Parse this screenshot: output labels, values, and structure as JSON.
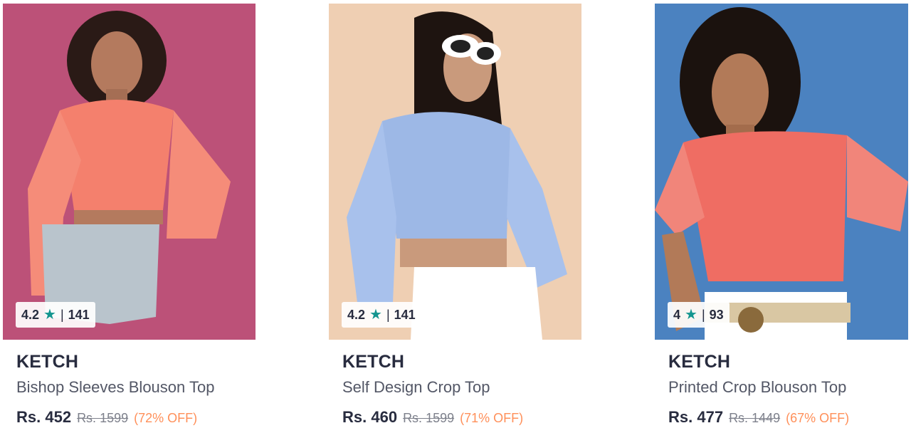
{
  "products": [
    {
      "brand": "KETCH",
      "name": "Bishop Sleeves Blouson Top",
      "rating": "4.2",
      "rating_count": "141",
      "price": "Rs. 452",
      "mrp": "Rs. 1599",
      "discount": "(72% OFF)",
      "image_colors": {
        "background": "#b84e74",
        "top": "#f4806d",
        "bottom": "#b9c4cc"
      }
    },
    {
      "brand": "KETCH",
      "name": "Self Design Crop Top",
      "rating": "4.2",
      "rating_count": "141",
      "price": "Rs. 460",
      "mrp": "Rs. 1599",
      "discount": "(71% OFF)",
      "image_colors": {
        "background": "#efcfb3",
        "top": "#9db8e6",
        "bottom": "#ffffff"
      }
    },
    {
      "brand": "KETCH",
      "name": "Printed Crop Blouson Top",
      "rating": "4",
      "rating_count": "93",
      "price": "Rs. 477",
      "mrp": "Rs. 1449",
      "discount": "(67% OFF)",
      "image_colors": {
        "background": "#4b82c0",
        "top": "#ef6d63",
        "bottom": "#ffffff"
      }
    }
  ],
  "rating_separator": "|",
  "star_icon": "star-icon",
  "colors": {
    "star": "#14958f",
    "discount": "#ff905a",
    "text": "#282c3f",
    "muted": "#7e818c"
  }
}
